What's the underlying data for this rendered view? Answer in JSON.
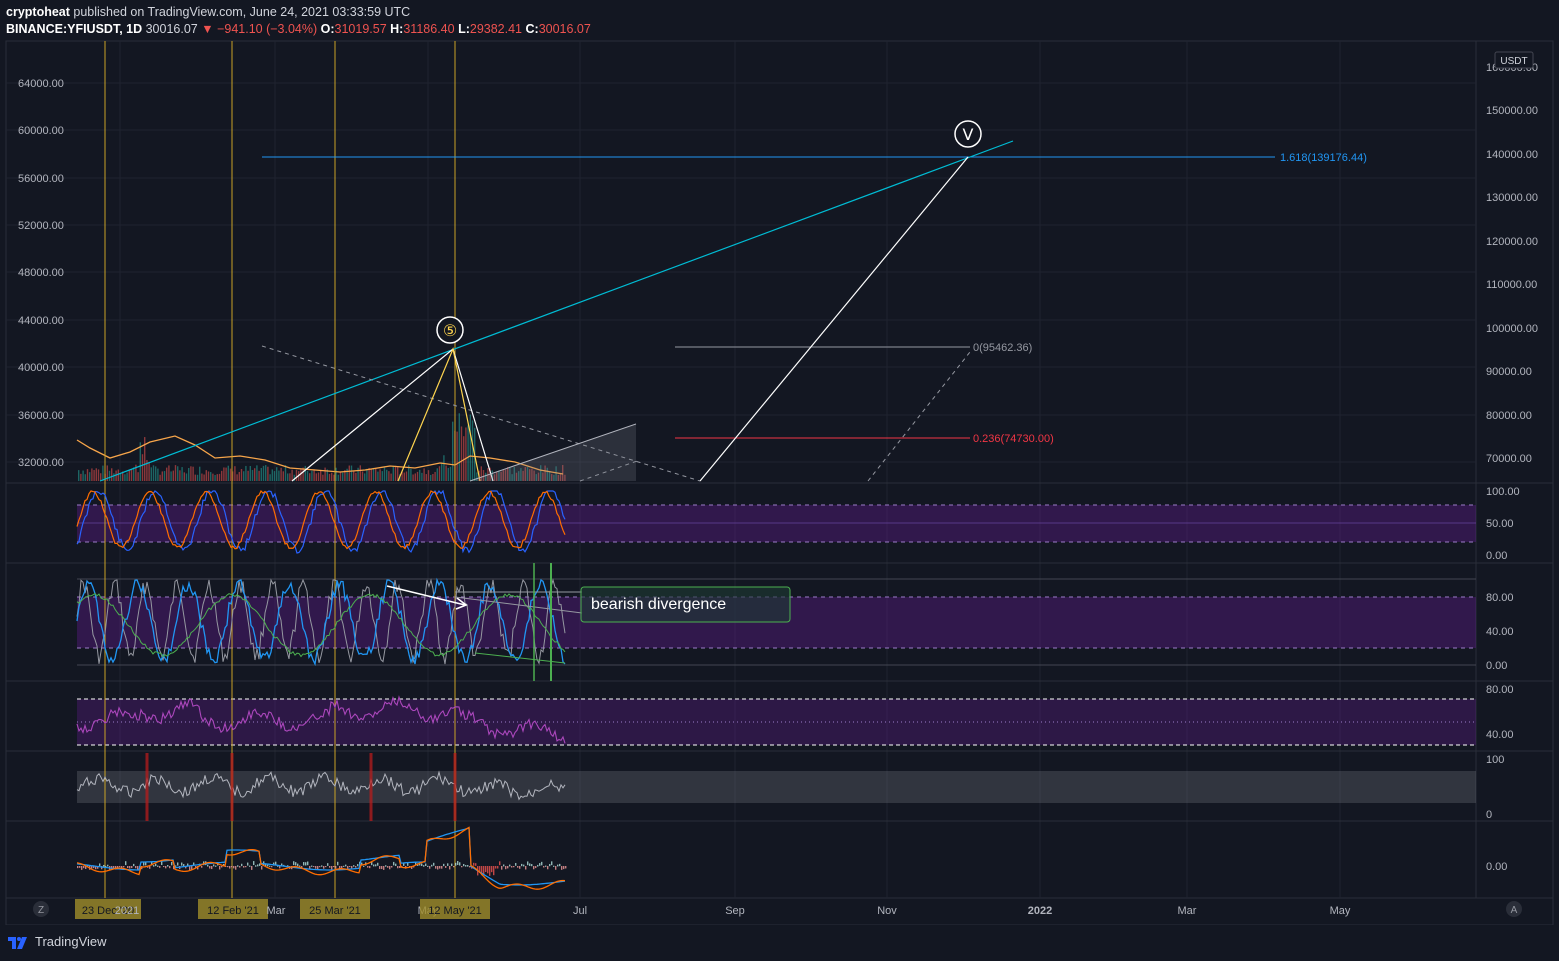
{
  "header": {
    "author": "cryptoheat",
    "published": "published on TradingView.com, June 24, 2021 03:33:59 UTC",
    "symbol": "BINANCE:YFIUSDT, 1D",
    "last": "30016.07",
    "change": "▼ −941.10 (−3.04%)",
    "open_label": "O:",
    "open": "31019.57",
    "high_label": "H:",
    "high": "31186.40",
    "low_label": "L:",
    "low": "29382.41",
    "close_label": "C:",
    "close": "30016.07"
  },
  "currency_badge": "USDT",
  "chart_data": {
    "type": "line",
    "left_axis_ticks": [
      "64000.00",
      "60000.00",
      "56000.00",
      "52000.00",
      "48000.00",
      "44000.00",
      "40000.00",
      "36000.00",
      "32000.00"
    ],
    "right_axis_ticks": [
      "160000.00",
      "150000.00",
      "140000.00",
      "130000.00",
      "120000.00",
      "110000.00",
      "100000.00",
      "90000.00",
      "80000.00",
      "70000.00"
    ],
    "fib_levels": [
      {
        "label": "1.618(139176.44)",
        "color": "#2196f3"
      },
      {
        "label": "0(95462.36)",
        "color": "#9598a1"
      },
      {
        "label": "0.236(74730.00)",
        "color": "#f23645"
      }
    ],
    "wave_labels": [
      "⑤",
      "Ⅴ"
    ],
    "annotation": "bearish divergence",
    "pane_ticks": {
      "stoch_rsi": [
        "100.00",
        "50.00",
        "0.00"
      ],
      "stoch": [
        "80.00",
        "40.00",
        "0.00"
      ],
      "rsi": [
        "80.00",
        "40.00"
      ],
      "mfi": [
        "100",
        "0"
      ],
      "macd": [
        "0.00"
      ]
    },
    "x_axis": [
      "23 Dec '20",
      "2021",
      "12 Feb '21",
      "Mar",
      "25 Mar '21",
      "May",
      "12 May '21",
      "Jul",
      "Sep",
      "Nov",
      "2022",
      "Mar",
      "May"
    ],
    "axis_buttons": [
      "Z",
      "A"
    ]
  },
  "footer": {
    "brand": "TradingView"
  }
}
